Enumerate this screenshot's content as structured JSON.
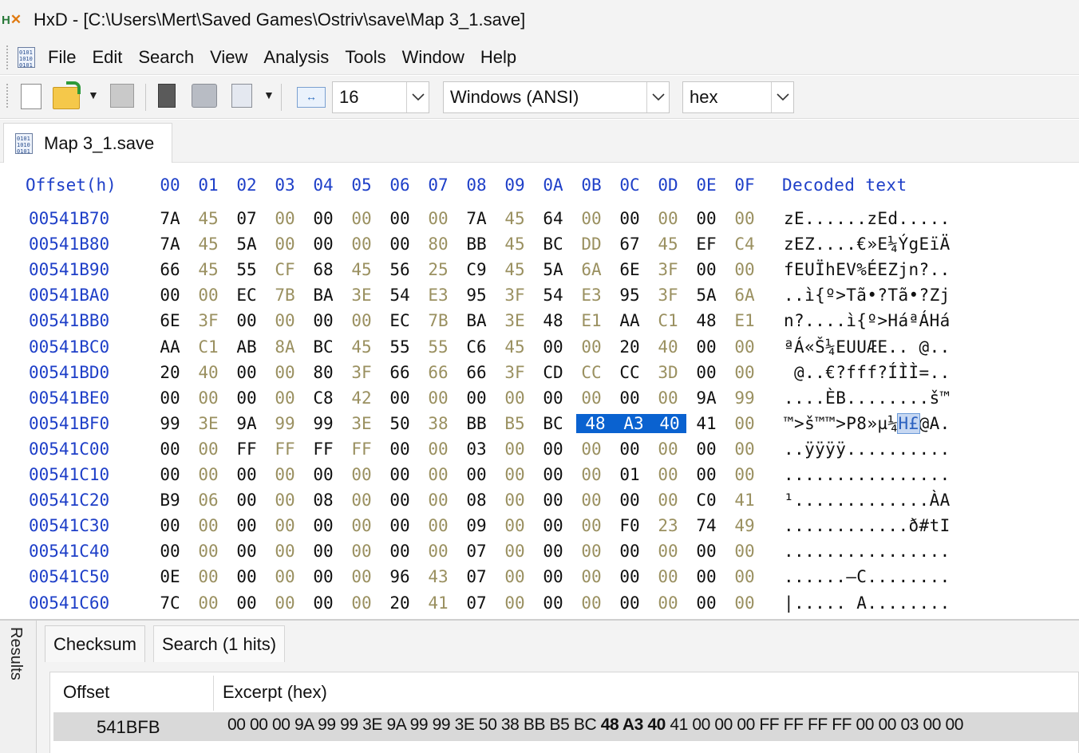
{
  "window": {
    "app_icon_text": "HxD",
    "title": "HxD - [C:\\Users\\Mert\\Saved Games\\Ostriv\\save\\Map 3_1.save]"
  },
  "menu": [
    "File",
    "Edit",
    "Search",
    "View",
    "Analysis",
    "Tools",
    "Window",
    "Help"
  ],
  "toolbar": {
    "bytes_per_row": "16",
    "charset": "Windows (ANSI)",
    "offset_base": "hex"
  },
  "tab": {
    "label": "Map 3_1.save"
  },
  "hex": {
    "header": {
      "offset": "Offset(h)",
      "columns": [
        "00",
        "01",
        "02",
        "03",
        "04",
        "05",
        "06",
        "07",
        "08",
        "09",
        "0A",
        "0B",
        "0C",
        "0D",
        "0E",
        "0F"
      ],
      "decoded": "Decoded text"
    },
    "rows": [
      {
        "offset": "00541B70",
        "bytes": [
          "7A",
          "45",
          "07",
          "00",
          "00",
          "00",
          "00",
          "00",
          "7A",
          "45",
          "64",
          "00",
          "00",
          "00",
          "00",
          "00"
        ],
        "text": "zE......zEd....."
      },
      {
        "offset": "00541B80",
        "bytes": [
          "7A",
          "45",
          "5A",
          "00",
          "00",
          "00",
          "00",
          "80",
          "BB",
          "45",
          "BC",
          "DD",
          "67",
          "45",
          "EF",
          "C4"
        ],
        "text": "zEZ....€»E¼ÝgEïÄ"
      },
      {
        "offset": "00541B90",
        "bytes": [
          "66",
          "45",
          "55",
          "CF",
          "68",
          "45",
          "56",
          "25",
          "C9",
          "45",
          "5A",
          "6A",
          "6E",
          "3F",
          "00",
          "00"
        ],
        "text": "fEUÏhEV%ÉEZjn?.."
      },
      {
        "offset": "00541BA0",
        "bytes": [
          "00",
          "00",
          "EC",
          "7B",
          "BA",
          "3E",
          "54",
          "E3",
          "95",
          "3F",
          "54",
          "E3",
          "95",
          "3F",
          "5A",
          "6A"
        ],
        "text": "..ì{º>Tã•?Tã•?Zj"
      },
      {
        "offset": "00541BB0",
        "bytes": [
          "6E",
          "3F",
          "00",
          "00",
          "00",
          "00",
          "EC",
          "7B",
          "BA",
          "3E",
          "48",
          "E1",
          "AA",
          "C1",
          "48",
          "E1"
        ],
        "text": "n?....ì{º>HáªÁHá"
      },
      {
        "offset": "00541BC0",
        "bytes": [
          "AA",
          "C1",
          "AB",
          "8A",
          "BC",
          "45",
          "55",
          "55",
          "C6",
          "45",
          "00",
          "00",
          "20",
          "40",
          "00",
          "00"
        ],
        "text": "ªÁ«Š¼EUUÆE.. @.."
      },
      {
        "offset": "00541BD0",
        "bytes": [
          "20",
          "40",
          "00",
          "00",
          "80",
          "3F",
          "66",
          "66",
          "66",
          "3F",
          "CD",
          "CC",
          "CC",
          "3D",
          "00",
          "00"
        ],
        "text": " @..€?fff?ÍÌÌ=.."
      },
      {
        "offset": "00541BE0",
        "bytes": [
          "00",
          "00",
          "00",
          "00",
          "C8",
          "42",
          "00",
          "00",
          "00",
          "00",
          "00",
          "00",
          "00",
          "00",
          "9A",
          "99"
        ],
        "text": "....ÈB........š™"
      },
      {
        "offset": "00541BF0",
        "bytes": [
          "99",
          "3E",
          "9A",
          "99",
          "99",
          "3E",
          "50",
          "38",
          "BB",
          "B5",
          "BC",
          "48",
          "A3",
          "40",
          "41",
          "00"
        ],
        "text": "™>š™™>P8»µ¼H£@A."
      },
      {
        "offset": "00541C00",
        "bytes": [
          "00",
          "00",
          "FF",
          "FF",
          "FF",
          "FF",
          "00",
          "00",
          "03",
          "00",
          "00",
          "00",
          "00",
          "00",
          "00",
          "00"
        ],
        "text": "..ÿÿÿÿ.........."
      },
      {
        "offset": "00541C10",
        "bytes": [
          "00",
          "00",
          "00",
          "00",
          "00",
          "00",
          "00",
          "00",
          "00",
          "00",
          "00",
          "00",
          "01",
          "00",
          "00",
          "00"
        ],
        "text": "................"
      },
      {
        "offset": "00541C20",
        "bytes": [
          "B9",
          "06",
          "00",
          "00",
          "08",
          "00",
          "00",
          "00",
          "08",
          "00",
          "00",
          "00",
          "00",
          "00",
          "C0",
          "41"
        ],
        "text": "¹.............ÀA"
      },
      {
        "offset": "00541C30",
        "bytes": [
          "00",
          "00",
          "00",
          "00",
          "00",
          "00",
          "00",
          "00",
          "09",
          "00",
          "00",
          "00",
          "F0",
          "23",
          "74",
          "49"
        ],
        "text": "............ð#tI"
      },
      {
        "offset": "00541C40",
        "bytes": [
          "00",
          "00",
          "00",
          "00",
          "00",
          "00",
          "00",
          "00",
          "07",
          "00",
          "00",
          "00",
          "00",
          "00",
          "00",
          "00"
        ],
        "text": "................"
      },
      {
        "offset": "00541C50",
        "bytes": [
          "0E",
          "00",
          "00",
          "00",
          "00",
          "00",
          "96",
          "43",
          "07",
          "00",
          "00",
          "00",
          "00",
          "00",
          "00",
          "00"
        ],
        "text": "......–C........"
      },
      {
        "offset": "00541C60",
        "bytes": [
          "7C",
          "00",
          "00",
          "00",
          "00",
          "00",
          "20",
          "41",
          "07",
          "00",
          "00",
          "00",
          "00",
          "00",
          "00",
          "00"
        ],
        "text": "|..... A........"
      }
    ]
  },
  "results": {
    "panel_label": "Results",
    "tabs": [
      "Checksum",
      "Search (1 hits)"
    ],
    "columns": [
      "Offset",
      "Excerpt (hex)"
    ],
    "row": {
      "offset": "541BFB",
      "excerpt_before": "00 00 00 9A 99 99 3E 9A 99 99 3E 50 38 BB B5 BC",
      "excerpt_match": "48 A3 40",
      "excerpt_after": "41 00 00 00 FF FF FF FF 00 00 03 00 00"
    }
  }
}
